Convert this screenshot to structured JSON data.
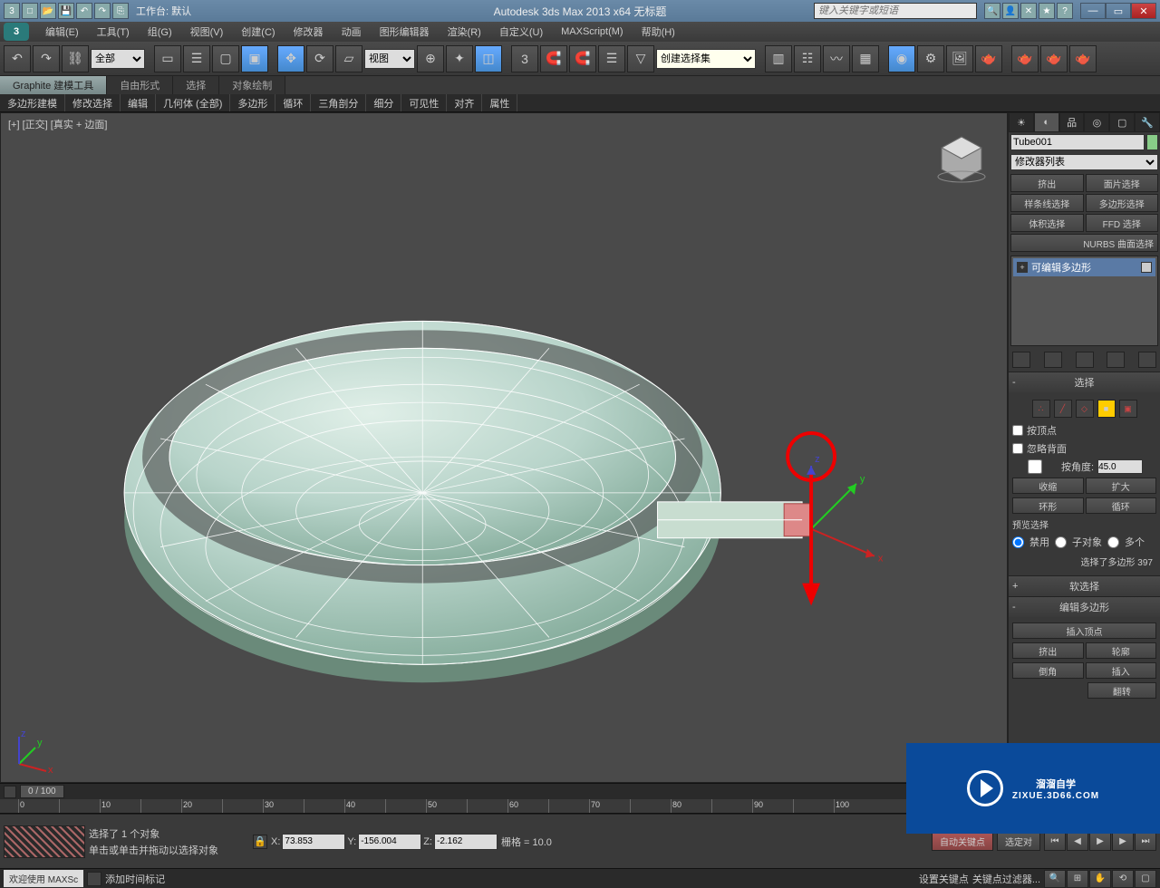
{
  "titlebar": {
    "workspace_label": "工作台: 默认",
    "app_title": "Autodesk 3ds Max  2013 x64      无标题",
    "search_placeholder": "键入关键字或短语"
  },
  "menu": {
    "items": [
      "编辑(E)",
      "工具(T)",
      "组(G)",
      "视图(V)",
      "创建(C)",
      "修改器",
      "动画",
      "图形编辑器",
      "渲染(R)",
      "自定义(U)",
      "MAXScript(M)",
      "帮助(H)"
    ]
  },
  "toolbar": {
    "selection_filter": "全部",
    "ref_coord": "视图",
    "named_set_placeholder": "创建选择集"
  },
  "ribbon": {
    "tabs": [
      "Graphite 建模工具",
      "自由形式",
      "选择",
      "对象绘制"
    ],
    "subtabs": [
      "多边形建模",
      "修改选择",
      "编辑",
      "几何体 (全部)",
      "多边形",
      "循环",
      "三角剖分",
      "细分",
      "可见性",
      "对齐",
      "属性"
    ]
  },
  "viewport": {
    "label": "[+] [正交]  [真实 + 边面]"
  },
  "cmd_panel": {
    "object_name": "Tube001",
    "modifier_list_label": "修改器列表",
    "buttons": [
      "挤出",
      "面片选择",
      "样条线选择",
      "多边形选择",
      "体积选择",
      "FFD 选择"
    ],
    "nurbs_label": "NURBS 曲面选择",
    "stack_item": "可编辑多边形",
    "rollouts": {
      "selection": {
        "title": "选择",
        "by_vertex": "按顶点",
        "ignore_backfacing": "忽略背面",
        "by_angle": "按角度:",
        "angle_value": "45.0",
        "shrink": "收缩",
        "grow": "扩大",
        "ring": "环形",
        "loop": "循环",
        "preview_label": "预览选择",
        "preview_off": "禁用",
        "preview_subobj": "子对象",
        "preview_multi": "多个",
        "selected_count": "选择了多边形 397"
      },
      "soft_selection": {
        "title": "软选择"
      },
      "edit_poly": {
        "title": "编辑多边形",
        "insert_vertex": "插入顶点",
        "extrude": "挤出",
        "outline": "轮廓",
        "bevel": "倒角",
        "inset": "插入",
        "flip": "翻转"
      }
    }
  },
  "timeline": {
    "frame_display": "0 / 100"
  },
  "status": {
    "selected_msg": "选择了 1 个对象",
    "prompt_msg": "单击或单击并拖动以选择对象",
    "x_label": "X:",
    "x_value": "73.853",
    "y_label": "Y:",
    "y_value": "-156.004",
    "z_label": "Z:",
    "z_value": "-2.162",
    "grid_label": "栅格 = 10.0",
    "auto_key": "自动关键点",
    "set_key": "设置关键点",
    "selected_btn": "选定对",
    "key_filters": "关键点过滤器...",
    "add_time_tag": "添加时间标记",
    "welcome": "欢迎使用  MAXSc"
  },
  "watermark": {
    "main": "溜溜自学",
    "sub": "ZIXUE.3D66.COM"
  }
}
